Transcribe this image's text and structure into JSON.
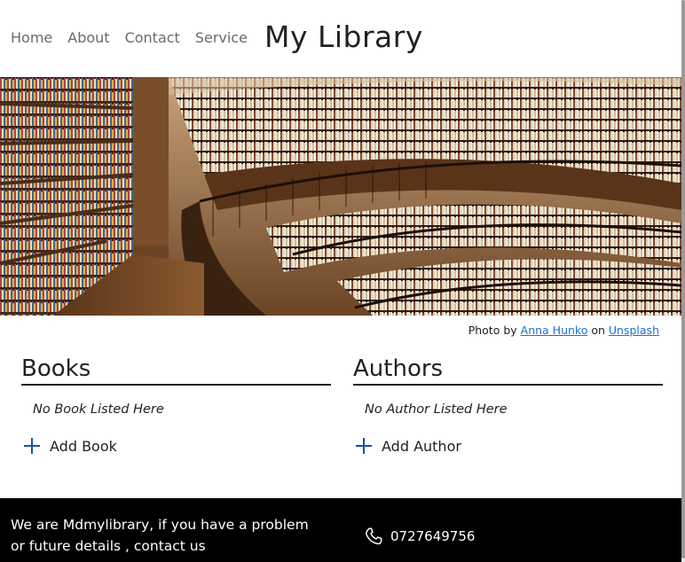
{
  "nav": {
    "items": [
      "Home",
      "About",
      "Contact",
      "Service"
    ]
  },
  "header": {
    "title": "My Library"
  },
  "hero": {
    "credit_prefix": "Photo by",
    "credit_author": "Anna Hunko",
    "credit_on": "on",
    "credit_source": "Unsplash"
  },
  "books": {
    "heading": "Books",
    "empty_text": "No Book Listed Here",
    "add_label": "Add Book"
  },
  "authors": {
    "heading": "Authors",
    "empty_text": "No Author Listed Here",
    "add_label": "Add Author"
  },
  "footer": {
    "about_line1": "We are Mdmylibrary, if you have a problem",
    "about_line2": "or future details , contact us",
    "phone": "0727649756"
  },
  "colors": {
    "link": "#1a6fd6",
    "plus_icon": "#1e4fa0",
    "footer_bg": "#000000",
    "nav_text": "#6a6a6a"
  },
  "icons": {
    "add": "plus-icon",
    "phone": "phone-icon"
  }
}
